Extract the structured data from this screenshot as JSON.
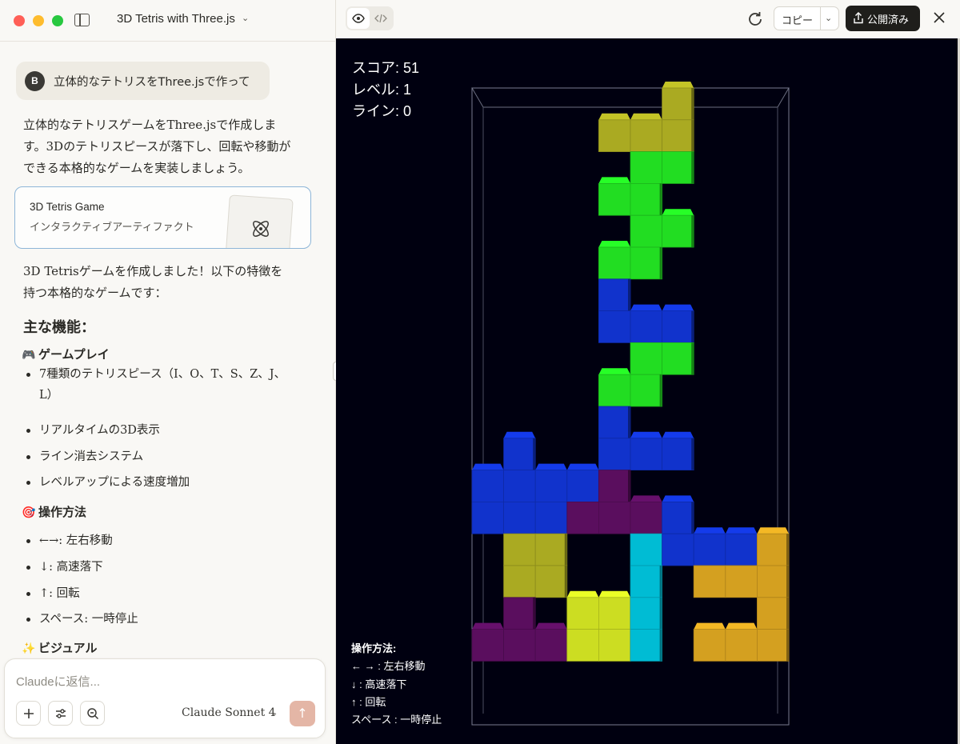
{
  "window": {
    "title": "3D Tetris with Three.js"
  },
  "user_message": {
    "avatar_letter": "B",
    "text": "立体的なテトリスをThree.jsで作って"
  },
  "assistant": {
    "intro": "立体的なテトリスゲームをThree.jsで作成します。3Dのテトリスピースが落下し、回転や移動ができる本格的なゲームを実装しましょう。",
    "artifact": {
      "name": "3D Tetris Game",
      "type": "インタラクティブアーティファクト",
      "icon": "atom-icon"
    },
    "after": "3D Tetrisゲームを作成しました！以下の特徴を持つ本格的なゲームです：",
    "heading": "主な機能：",
    "sections": [
      {
        "emoji": "🎮",
        "title": "ゲームプレイ",
        "items": [
          "7種類のテトリスピース（I、O、T、S、Z、J、L）",
          "リアルタイムの3D表示",
          "ライン消去システム",
          "レベルアップによる速度増加"
        ]
      },
      {
        "emoji": "🎯",
        "title": "操作方法",
        "items": [
          "←→: 左右移動",
          "↓: 高速落下",
          "↑: 回転",
          "スペース: 一時停止"
        ]
      },
      {
        "emoji": "✨",
        "title": "ビジュアル"
      }
    ]
  },
  "composer": {
    "placeholder": "Claudeに返信...",
    "model": "Claude Sonnet 4"
  },
  "toolbar": {
    "copy_label": "コピー",
    "publish_label": "公開済み"
  },
  "game": {
    "score_text": "スコア: 51",
    "level_text": "レベル: 1",
    "lines_text": "ライン: 0",
    "controls_title": "操作方法:",
    "controls": [
      "← → : 左右移動",
      "↓ : 高速落下",
      "↑ : 回転",
      "スペース : 一時停止"
    ],
    "colors": {
      "background": "#000010",
      "I": "#00bcd4",
      "O": "#ccdd22",
      "T": "#5a0e5e",
      "S": "#22dd22",
      "Z": "#aaaa22",
      "J": "#1133cc",
      "L": "#d4a020"
    },
    "grid_cols": 10,
    "grid_rows": 20,
    "cells": [
      {
        "c": 6,
        "r": 0,
        "k": "Z"
      },
      {
        "c": 4,
        "r": 1,
        "k": "Z"
      },
      {
        "c": 5,
        "r": 1,
        "k": "Z"
      },
      {
        "c": 6,
        "r": 1,
        "k": "Z"
      },
      {
        "c": 5,
        "r": 2,
        "k": "S"
      },
      {
        "c": 6,
        "r": 2,
        "k": "S"
      },
      {
        "c": 4,
        "r": 3,
        "k": "S"
      },
      {
        "c": 5,
        "r": 3,
        "k": "S"
      },
      {
        "c": 5,
        "r": 4,
        "k": "S"
      },
      {
        "c": 6,
        "r": 4,
        "k": "S"
      },
      {
        "c": 4,
        "r": 5,
        "k": "S"
      },
      {
        "c": 5,
        "r": 5,
        "k": "S"
      },
      {
        "c": 4,
        "r": 6,
        "k": "J"
      },
      {
        "c": 4,
        "r": 7,
        "k": "J"
      },
      {
        "c": 5,
        "r": 7,
        "k": "J"
      },
      {
        "c": 6,
        "r": 7,
        "k": "J"
      },
      {
        "c": 5,
        "r": 8,
        "k": "S"
      },
      {
        "c": 6,
        "r": 8,
        "k": "S"
      },
      {
        "c": 4,
        "r": 9,
        "k": "S"
      },
      {
        "c": 5,
        "r": 9,
        "k": "S"
      },
      {
        "c": 4,
        "r": 10,
        "k": "J"
      },
      {
        "c": 1,
        "r": 11,
        "k": "J"
      },
      {
        "c": 4,
        "r": 11,
        "k": "J"
      },
      {
        "c": 5,
        "r": 11,
        "k": "J"
      },
      {
        "c": 6,
        "r": 11,
        "k": "J"
      },
      {
        "c": 0,
        "r": 12,
        "k": "J"
      },
      {
        "c": 1,
        "r": 12,
        "k": "J"
      },
      {
        "c": 2,
        "r": 12,
        "k": "J"
      },
      {
        "c": 3,
        "r": 12,
        "k": "J"
      },
      {
        "c": 4,
        "r": 12,
        "k": "T"
      },
      {
        "c": 0,
        "r": 13,
        "k": "J"
      },
      {
        "c": 1,
        "r": 13,
        "k": "J"
      },
      {
        "c": 2,
        "r": 13,
        "k": "J"
      },
      {
        "c": 3,
        "r": 13,
        "k": "T"
      },
      {
        "c": 4,
        "r": 13,
        "k": "T"
      },
      {
        "c": 5,
        "r": 13,
        "k": "T"
      },
      {
        "c": 6,
        "r": 13,
        "k": "J"
      },
      {
        "c": 1,
        "r": 14,
        "k": "Z"
      },
      {
        "c": 2,
        "r": 14,
        "k": "Z"
      },
      {
        "c": 5,
        "r": 14,
        "k": "I"
      },
      {
        "c": 6,
        "r": 14,
        "k": "J"
      },
      {
        "c": 7,
        "r": 14,
        "k": "J"
      },
      {
        "c": 8,
        "r": 14,
        "k": "J"
      },
      {
        "c": 9,
        "r": 14,
        "k": "L"
      },
      {
        "c": 1,
        "r": 15,
        "k": "Z"
      },
      {
        "c": 2,
        "r": 15,
        "k": "Z"
      },
      {
        "c": 5,
        "r": 15,
        "k": "I"
      },
      {
        "c": 7,
        "r": 15,
        "k": "L"
      },
      {
        "c": 8,
        "r": 15,
        "k": "L"
      },
      {
        "c": 9,
        "r": 15,
        "k": "L"
      },
      {
        "c": 1,
        "r": 16,
        "k": "T"
      },
      {
        "c": 3,
        "r": 16,
        "k": "O"
      },
      {
        "c": 4,
        "r": 16,
        "k": "O"
      },
      {
        "c": 5,
        "r": 16,
        "k": "I"
      },
      {
        "c": 9,
        "r": 16,
        "k": "L"
      },
      {
        "c": 0,
        "r": 17,
        "k": "T"
      },
      {
        "c": 1,
        "r": 17,
        "k": "T"
      },
      {
        "c": 2,
        "r": 17,
        "k": "T"
      },
      {
        "c": 3,
        "r": 17,
        "k": "O"
      },
      {
        "c": 4,
        "r": 17,
        "k": "O"
      },
      {
        "c": 5,
        "r": 17,
        "k": "I"
      },
      {
        "c": 7,
        "r": 17,
        "k": "L"
      },
      {
        "c": 8,
        "r": 17,
        "k": "L"
      },
      {
        "c": 9,
        "r": 17,
        "k": "L"
      }
    ]
  }
}
